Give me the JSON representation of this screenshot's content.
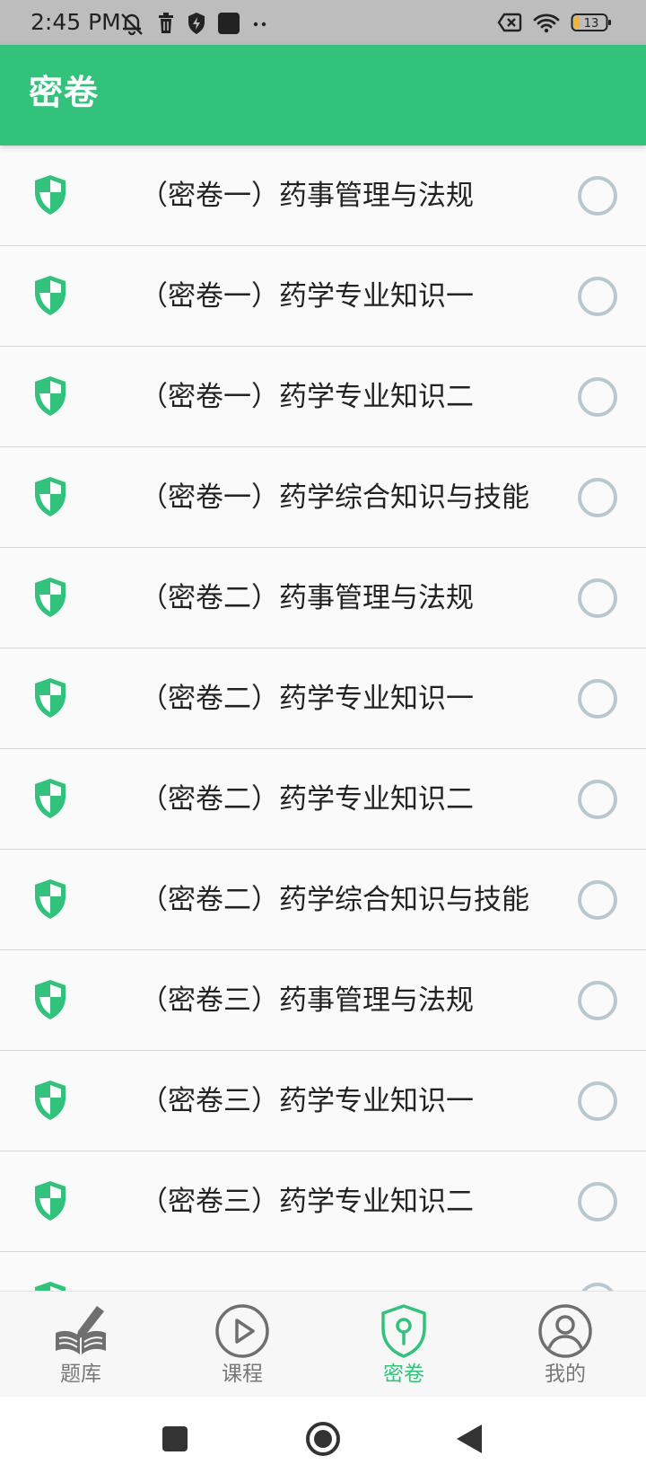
{
  "status_bar": {
    "time": "2:45 PM",
    "battery_level": "13"
  },
  "app_bar": {
    "title": "密卷"
  },
  "list": {
    "items": [
      {
        "label": "（密卷一）药事管理与法规"
      },
      {
        "label": "（密卷一）药学专业知识一"
      },
      {
        "label": "（密卷一）药学专业知识二"
      },
      {
        "label": "（密卷一）药学综合知识与技能"
      },
      {
        "label": "（密卷二）药事管理与法规"
      },
      {
        "label": "（密卷二）药学专业知识一"
      },
      {
        "label": "（密卷二）药学专业知识二"
      },
      {
        "label": "（密卷二）药学综合知识与技能"
      },
      {
        "label": "（密卷三）药事管理与法规"
      },
      {
        "label": "（密卷三）药学专业知识一"
      },
      {
        "label": "（密卷三）药学专业知识二"
      }
    ],
    "partial_item": {
      "label": ""
    }
  },
  "bottom_nav": {
    "items": [
      {
        "label": "题库",
        "icon": "book-pencil-icon",
        "active": false
      },
      {
        "label": "课程",
        "icon": "play-circle-icon",
        "active": false
      },
      {
        "label": "密卷",
        "icon": "shield-key-icon",
        "active": true
      },
      {
        "label": "我的",
        "icon": "user-circle-icon",
        "active": false
      }
    ]
  },
  "colors": {
    "accent": "#32c27b",
    "radio_border": "#b9c7cf",
    "status_bar_bg": "#bdbdbd",
    "text_primary": "#222222",
    "text_secondary": "#777777"
  }
}
